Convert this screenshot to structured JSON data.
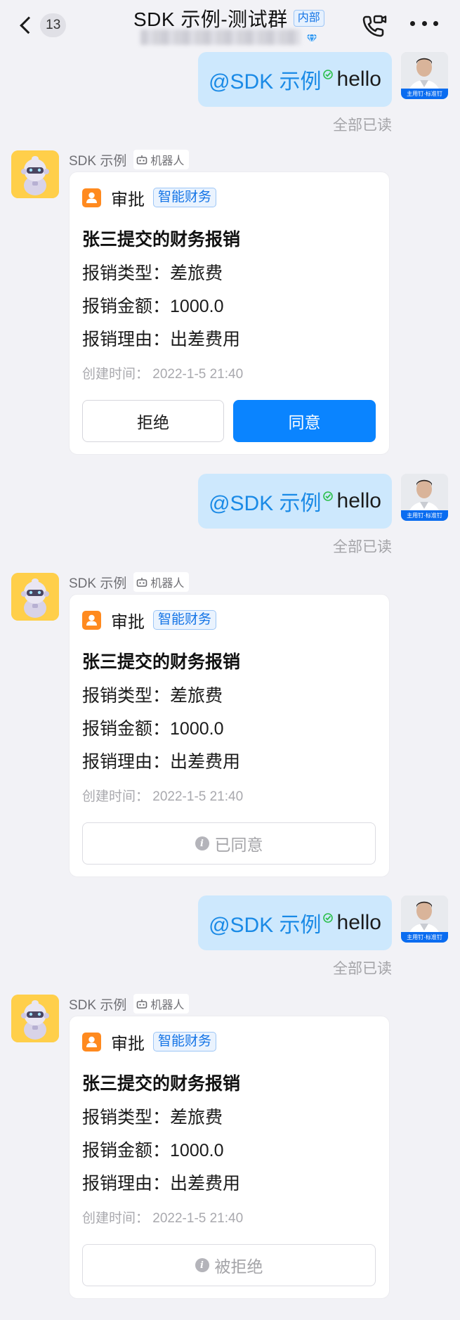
{
  "header": {
    "unread_count": "13",
    "title": "SDK 示例-测试群",
    "internal_tag": "内部"
  },
  "sent_messages": [
    {
      "mention": "@SDK 示例",
      "text": "hello",
      "read_status": "全部已读"
    },
    {
      "mention": "@SDK 示例",
      "text": "hello",
      "read_status": "全部已读"
    },
    {
      "mention": "@SDK 示例",
      "text": "hello",
      "read_status": "全部已读"
    }
  ],
  "self_avatar_caption": "主用钉·标准钉",
  "robot_messages": [
    {
      "sender": "SDK 示例",
      "sender_tag": "机器人",
      "app_name": "审批",
      "app_tag": "智能财务",
      "card_title": "张三提交的财务报销",
      "fields": [
        {
          "label": "报销类型：",
          "value": "差旅费"
        },
        {
          "label": "报销金额：",
          "value": "1000.0"
        },
        {
          "label": "报销理由：",
          "value": "出差费用"
        }
      ],
      "created": "创建时间：  2022-1-5 21:40",
      "reject_label": "拒绝",
      "agree_label": "同意"
    },
    {
      "sender": "SDK 示例",
      "sender_tag": "机器人",
      "app_name": "审批",
      "app_tag": "智能财务",
      "card_title": "张三提交的财务报销",
      "fields": [
        {
          "label": "报销类型：",
          "value": "差旅费"
        },
        {
          "label": "报销金额：",
          "value": "1000.0"
        },
        {
          "label": "报销理由：",
          "value": "出差费用"
        }
      ],
      "created": "创建时间：  2022-1-5 21:40",
      "status_label": "已同意"
    },
    {
      "sender": "SDK 示例",
      "sender_tag": "机器人",
      "app_name": "审批",
      "app_tag": "智能财务",
      "card_title": "张三提交的财务报销",
      "fields": [
        {
          "label": "报销类型：",
          "value": "差旅费"
        },
        {
          "label": "报销金额：",
          "value": "1000.0"
        },
        {
          "label": "报销理由：",
          "value": "出差费用"
        }
      ],
      "created": "创建时间：  2022-1-5 21:40",
      "status_label": "被拒绝"
    }
  ],
  "colors": {
    "accent": "#0a84ff",
    "bubble": "#cde8fd",
    "mention": "#1a8ae6",
    "approval_icon": "#ff8a1f",
    "robot_avatar_bg": "#ffcf4a",
    "background": "#f2f2f6"
  },
  "icons": [
    "back-chevron-icon",
    "diamond-icon",
    "phone-video-icon",
    "more-icon",
    "verified-check-icon",
    "robot-icon",
    "approval-person-icon",
    "info-icon"
  ]
}
